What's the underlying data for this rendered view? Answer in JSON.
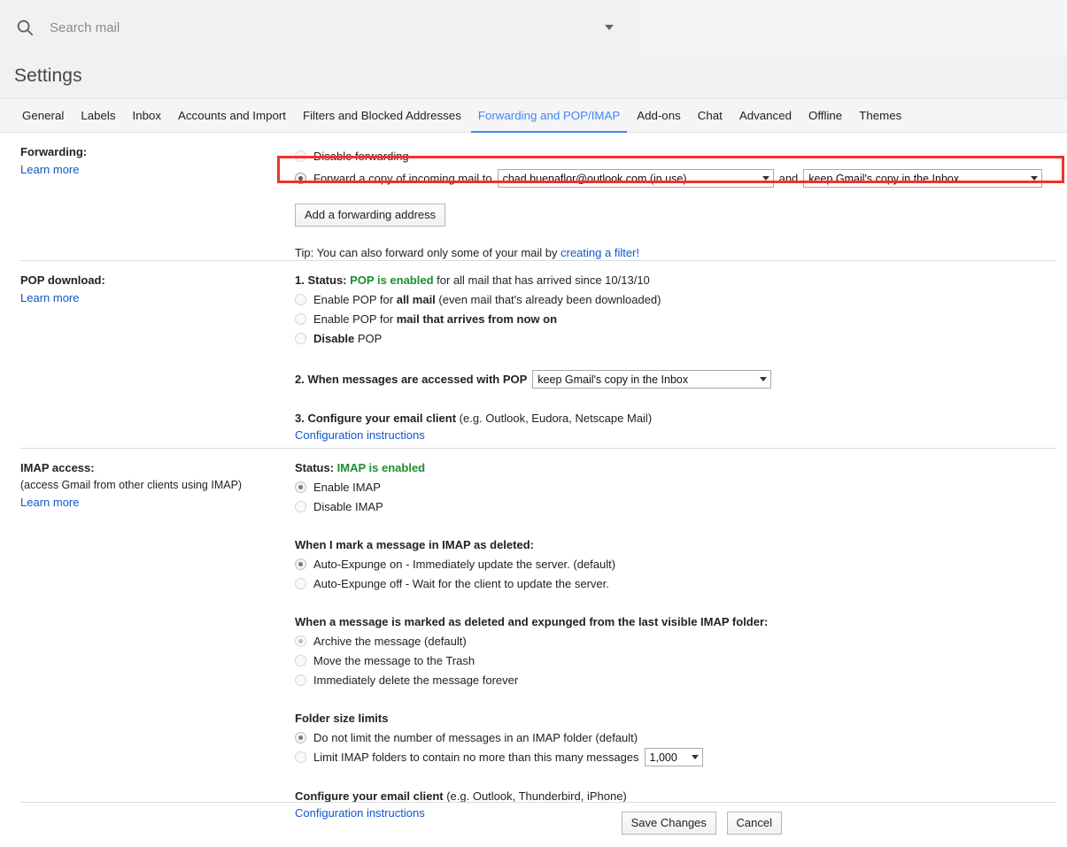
{
  "search": {
    "placeholder": "Search mail",
    "value": "",
    "icon": "search-icon",
    "options_icon": "chevron-down-icon"
  },
  "header": {
    "title": "Settings"
  },
  "tabs": [
    {
      "label": "General",
      "active": false
    },
    {
      "label": "Labels",
      "active": false
    },
    {
      "label": "Inbox",
      "active": false
    },
    {
      "label": "Accounts and Import",
      "active": false
    },
    {
      "label": "Filters and Blocked Addresses",
      "active": false
    },
    {
      "label": "Forwarding and POP/IMAP",
      "active": true
    },
    {
      "label": "Add-ons",
      "active": false
    },
    {
      "label": "Chat",
      "active": false
    },
    {
      "label": "Advanced",
      "active": false
    },
    {
      "label": "Offline",
      "active": false
    },
    {
      "label": "Themes",
      "active": false
    }
  ],
  "forwarding": {
    "label": "Forwarding:",
    "learn_more": "Learn more",
    "disable_option": "Disable forwarding",
    "forward_option": "Forward a copy of incoming mail to",
    "address_select": "chad.buenaflor@outlook.com (in use)",
    "and_text": "and",
    "action_select": "keep Gmail's copy in the Inbox",
    "add_address_button": "Add a forwarding address",
    "tip_prefix": "Tip: You can also forward only some of your mail by ",
    "tip_link": "creating a filter!",
    "selected": "forward",
    "highlighted": true
  },
  "pop": {
    "label": "POP download:",
    "learn_more": "Learn more",
    "status_num": "1. Status: ",
    "status_value": "POP is enabled",
    "status_suffix": " for all mail that has arrived since 10/13/10",
    "opt_all_mail_pre": "Enable POP for ",
    "opt_all_mail_bold": "all mail",
    "opt_all_mail_post": " (even mail that's already been downloaded)",
    "opt_now_on_pre": "Enable POP for ",
    "opt_now_on_bold": "mail that arrives from now on",
    "opt_disable_bold": "Disable",
    "opt_disable_post": " POP",
    "step2_label": "2. When messages are accessed with POP",
    "step2_select": "keep Gmail's copy in the Inbox",
    "step3_bold": "3. Configure your email client",
    "step3_post": " (e.g. Outlook, Eudora, Netscape Mail)",
    "config_link": "Configuration instructions",
    "selected": "none"
  },
  "imap": {
    "label": "IMAP access:",
    "sub_label": "(access Gmail from other clients using IMAP)",
    "learn_more": "Learn more",
    "status_label": "Status: ",
    "status_value": "IMAP is enabled",
    "enable_option": "Enable IMAP",
    "disable_option": "Disable IMAP",
    "selected_access": "enable",
    "deleted_heading": "When I mark a message in IMAP as deleted:",
    "auto_expunge_on": "Auto-Expunge on - Immediately update the server. (default)",
    "auto_expunge_off": "Auto-Expunge off - Wait for the client to update the server.",
    "selected_expunge": "on",
    "expunged_heading": "When a message is marked as deleted and expunged from the last visible IMAP folder:",
    "archive_option": "Archive the message (default)",
    "trash_option": "Move the message to the Trash",
    "delete_option": "Immediately delete the message forever",
    "selected_expunged_action": "archive",
    "folder_limits_heading": "Folder size limits",
    "no_limit_option": "Do not limit the number of messages in an IMAP folder (default)",
    "limit_option": "Limit IMAP folders to contain no more than this many messages",
    "limit_select": "1,000",
    "selected_folder_limit": "no-limit",
    "configure_bold": "Configure your email client",
    "configure_post": " (e.g. Outlook, Thunderbird, iPhone)",
    "config_link": "Configuration instructions"
  },
  "footer": {
    "save_label": "Save Changes",
    "cancel_label": "Cancel"
  },
  "colors": {
    "accent_blue": "#4285f4",
    "link_blue": "#1155cc",
    "status_green": "#1e8c2e",
    "highlight_red": "#f0322c"
  }
}
